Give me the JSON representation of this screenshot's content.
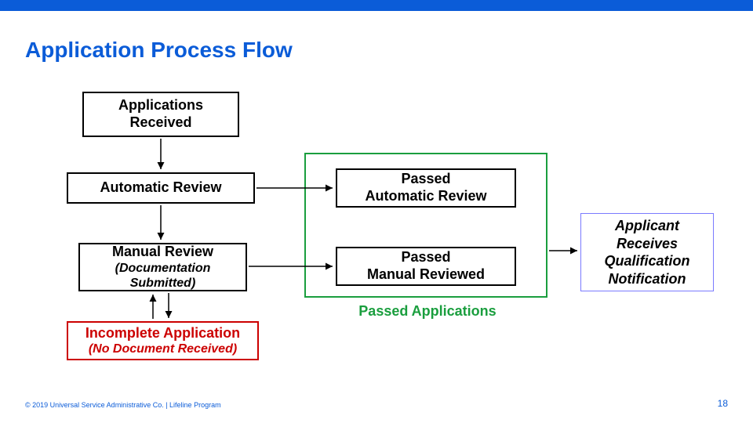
{
  "title": "Application Process Flow",
  "boxes": {
    "applications_received": "Applications\nReceived",
    "automatic_review": "Automatic Review",
    "manual_review": "Manual Review",
    "manual_review_sub": "(Documentation Submitted)",
    "incomplete_app": "Incomplete Application",
    "incomplete_app_sub": "(No Document Received)",
    "passed_auto": "Passed\nAutomatic Review",
    "passed_manual": "Passed\nManual Reviewed",
    "passed_apps_label": "Passed Applications",
    "notification": "Applicant Receives Qualification Notification"
  },
  "footer": "© 2019 Universal Service Administrative Co. | Lifeline Program",
  "page_number": "18"
}
